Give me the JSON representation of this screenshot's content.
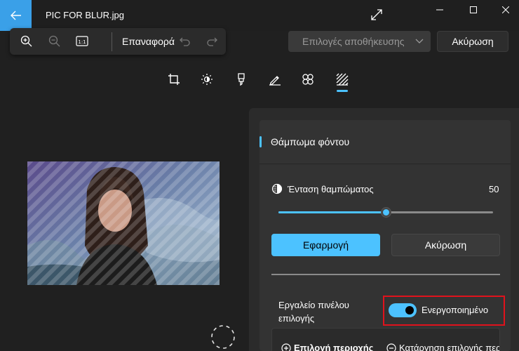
{
  "window": {
    "title": "PIC FOR BLUR.jpg"
  },
  "toolbar": {
    "reset_label": "Επαναφορά",
    "save_options_label": "Επιλογές αποθήκευσης",
    "cancel_label": "Ακύρωση"
  },
  "edit_tools": [
    {
      "name": "crop-icon"
    },
    {
      "name": "brightness-icon"
    },
    {
      "name": "marker-icon"
    },
    {
      "name": "draw-icon"
    },
    {
      "name": "erase-icon"
    },
    {
      "name": "background-blur-icon",
      "active": true
    }
  ],
  "panel": {
    "section_title": "Θάμπωμα φόντου",
    "intensity_label": "Ένταση θαμπώματος",
    "intensity_value": "50",
    "intensity_fraction": 0.5,
    "apply_label": "Εφαρμογή",
    "cancel_label": "Ακύρωση",
    "brush_tool_label": "Εργαλείο πινέλου επιλογής",
    "brush_tool_state": "Ενεργοποιημένο",
    "brush_tool_enabled": true,
    "select_area_label": "Επιλογή περιοχής",
    "deselect_area_label": "Κατάργηση επιλογής περιοχής"
  },
  "colors": {
    "accent": "#4cc2ff",
    "back_button": "#3aa0e8",
    "highlight_box": "#e0121c"
  }
}
